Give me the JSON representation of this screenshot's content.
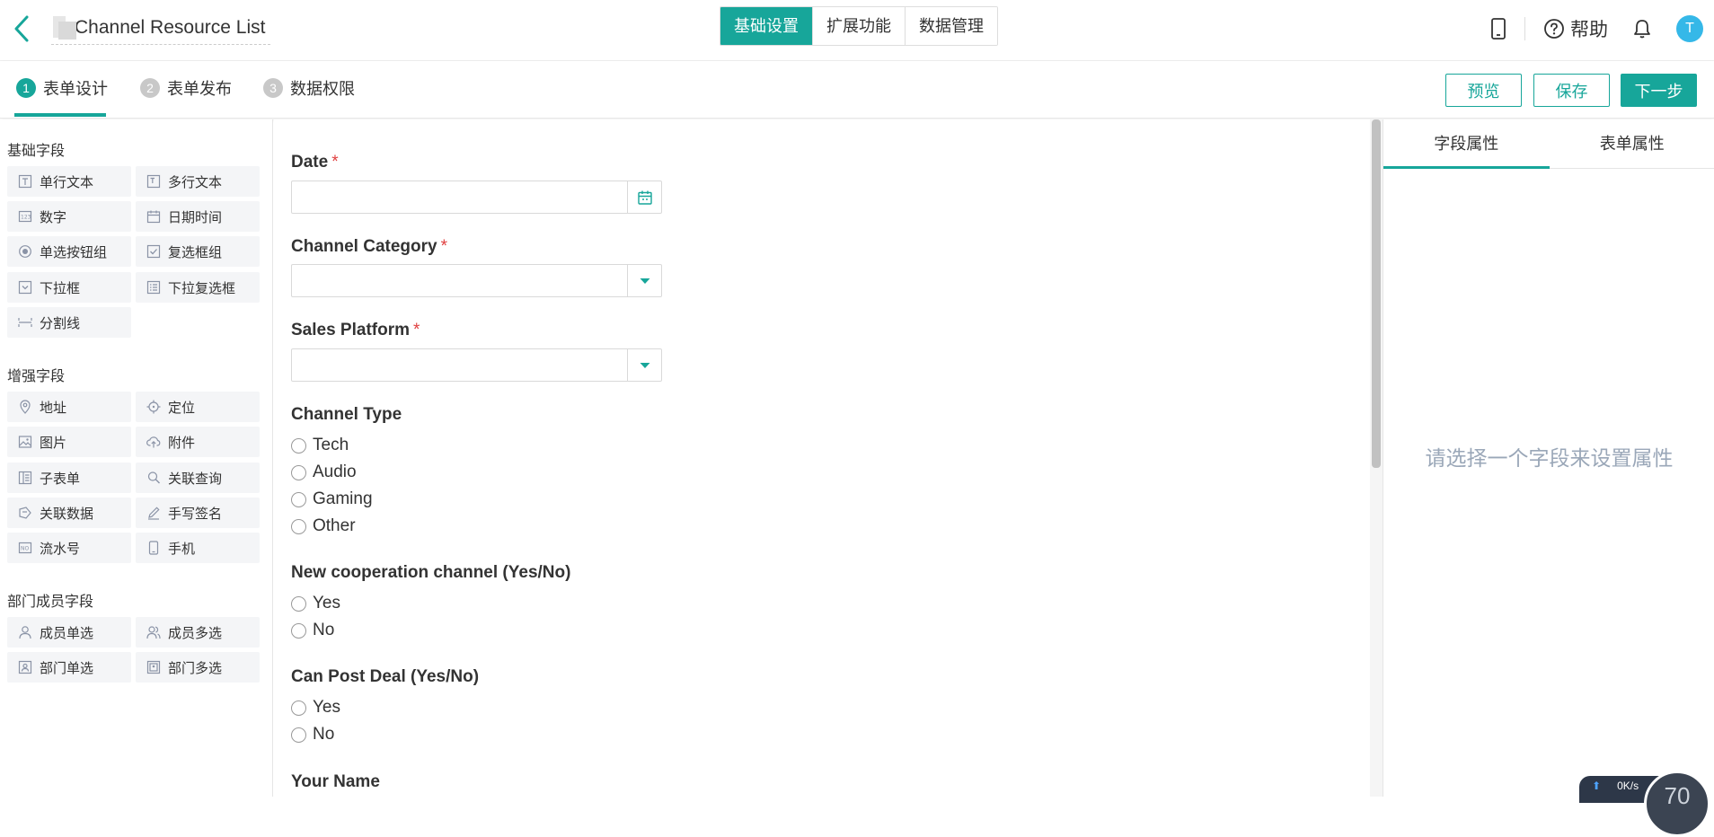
{
  "header": {
    "title": "Channel Resource List",
    "segments": [
      "基础设置",
      "扩展功能",
      "数据管理"
    ],
    "active_segment": "基础设置",
    "help_label": "帮助",
    "avatar_initial": "T",
    "accent_color": "#17a69a"
  },
  "steps": [
    {
      "num": "1",
      "label": "表单设计",
      "active": true
    },
    {
      "num": "2",
      "label": "表单发布",
      "active": false
    },
    {
      "num": "3",
      "label": "数据权限",
      "active": false
    }
  ],
  "actions": {
    "preview": "预览",
    "save": "保存",
    "next": "下一步"
  },
  "sidebar": {
    "basic_title": "基础字段",
    "basic_fields": [
      {
        "label": "单行文本",
        "icon": "text-icon"
      },
      {
        "label": "多行文本",
        "icon": "textarea-icon"
      },
      {
        "label": "数字",
        "icon": "number-icon"
      },
      {
        "label": "日期时间",
        "icon": "calendar-icon"
      },
      {
        "label": "单选按钮组",
        "icon": "radio-icon"
      },
      {
        "label": "复选框组",
        "icon": "checkbox-icon"
      },
      {
        "label": "下拉框",
        "icon": "dropdown-icon"
      },
      {
        "label": "下拉复选框",
        "icon": "multiselect-icon"
      },
      {
        "label": "分割线",
        "icon": "divider-icon"
      }
    ],
    "enhanced_title": "增强字段",
    "enhanced_fields": [
      {
        "label": "地址",
        "icon": "map-pin-icon"
      },
      {
        "label": "定位",
        "icon": "locate-icon"
      },
      {
        "label": "图片",
        "icon": "image-icon"
      },
      {
        "label": "附件",
        "icon": "upload-icon"
      },
      {
        "label": "子表单",
        "icon": "subform-icon"
      },
      {
        "label": "关联查询",
        "icon": "link-search-icon"
      },
      {
        "label": "关联数据",
        "icon": "link-data-icon"
      },
      {
        "label": "手写签名",
        "icon": "pen-icon"
      },
      {
        "label": "流水号",
        "icon": "serial-number-icon"
      },
      {
        "label": "手机",
        "icon": "phone-icon"
      }
    ],
    "member_title": "部门成员字段",
    "member_fields": [
      {
        "label": "成员单选",
        "icon": "user-icon"
      },
      {
        "label": "成员多选",
        "icon": "users-icon"
      },
      {
        "label": "部门单选",
        "icon": "department-icon"
      },
      {
        "label": "部门多选",
        "icon": "departments-icon"
      }
    ]
  },
  "form": {
    "date_label": "Date",
    "channel_category_label": "Channel Category",
    "sales_platform_label": "Sales Platform",
    "required_mark": "*",
    "channel_type_label": "Channel Type",
    "channel_type_options": [
      "Tech",
      "Audio",
      "Gaming",
      "Other"
    ],
    "new_coop_label": "New cooperation channel (Yes/No)",
    "new_coop_options": [
      "Yes",
      "No"
    ],
    "can_post_label": "Can Post Deal (Yes/No)",
    "can_post_options": [
      "Yes",
      "No"
    ],
    "your_name_label": "Your Name"
  },
  "properties": {
    "tabs": [
      "字段属性",
      "表单属性"
    ],
    "active_tab": "字段属性",
    "empty_hint": "请选择一个字段来设置属性"
  },
  "speed_widget": {
    "net_rate": "0K/s",
    "gauge_value": "70"
  }
}
